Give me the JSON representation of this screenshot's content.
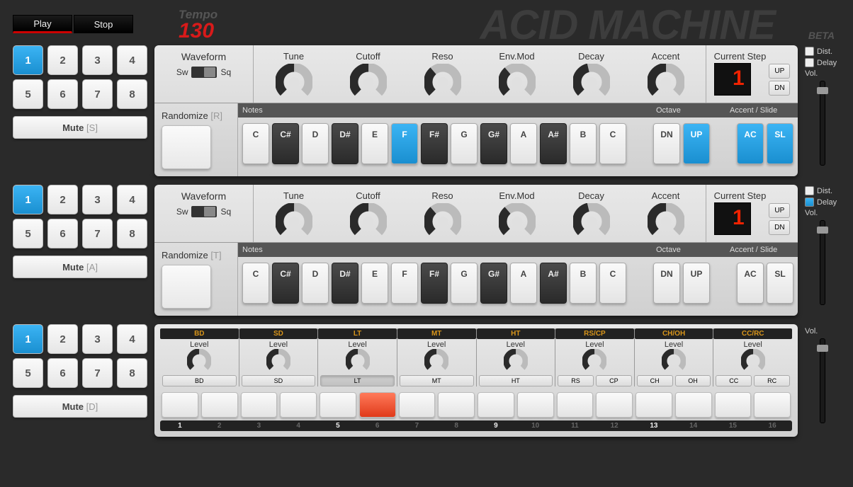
{
  "app": {
    "title": "ACID MACHINE",
    "beta": "BETA"
  },
  "transport": {
    "play": "Play",
    "stop": "Stop",
    "tempo_label": "Tempo",
    "tempo": "130"
  },
  "pattern_count": 8,
  "synth_labels": {
    "waveform": "Waveform",
    "sw": "Sw",
    "sq": "Sq",
    "knobs": [
      "Tune",
      "Cutoff",
      "Reso",
      "Env.Mod",
      "Decay",
      "Accent"
    ],
    "current_step": "Current Step",
    "up": "UP",
    "dn": "DN",
    "randomize": "Randomize",
    "notes_hdr": "Notes",
    "octave_hdr": "Octave",
    "accsl_hdr": "Accent / Slide",
    "notes": [
      "C",
      "C#",
      "D",
      "D#",
      "E",
      "F",
      "F#",
      "G",
      "G#",
      "A",
      "A#",
      "B",
      "C"
    ],
    "oct_dn": "DN",
    "oct_up": "UP",
    "ac": "AC",
    "sl": "SL",
    "level": "Level"
  },
  "synth1": {
    "active_pattern": 1,
    "mute_label": "Mute",
    "mute_key": "[S]",
    "rand_key": "[R]",
    "knob_values": [
      0.5,
      0.5,
      0.35,
      0.35,
      0.45,
      0.5
    ],
    "current_step": "1",
    "active_note": "F",
    "oct_active": "UP",
    "ac_on": true,
    "sl_on": true,
    "fx": {
      "dist_label": "Dist.",
      "dist_on": false,
      "delay_label": "Delay",
      "delay_on": false,
      "vol_label": "Vol."
    }
  },
  "synth2": {
    "active_pattern": 1,
    "mute_label": "Mute",
    "mute_key": "[A]",
    "rand_key": "[T]",
    "knob_values": [
      0.5,
      0.5,
      0.35,
      0.35,
      0.45,
      0.5
    ],
    "current_step": "1",
    "active_note": "",
    "oct_active": "",
    "ac_on": false,
    "sl_on": false,
    "fx": {
      "dist_label": "Dist.",
      "dist_on": false,
      "delay_label": "Delay",
      "delay_on": true,
      "vol_label": "Vol."
    }
  },
  "drums": {
    "active_pattern": 1,
    "mute_label": "Mute",
    "mute_key": "[D]",
    "lanes": [
      {
        "name": "BD",
        "btns": [
          "BD"
        ]
      },
      {
        "name": "SD",
        "btns": [
          "SD"
        ]
      },
      {
        "name": "LT",
        "btns": [
          "LT"
        ],
        "pressed": true
      },
      {
        "name": "MT",
        "btns": [
          "MT"
        ]
      },
      {
        "name": "HT",
        "btns": [
          "HT"
        ]
      },
      {
        "name": "RS/CP",
        "btns": [
          "RS",
          "CP"
        ]
      },
      {
        "name": "CH/OH",
        "btns": [
          "CH",
          "OH"
        ]
      },
      {
        "name": "CC/RC",
        "btns": [
          "CC",
          "RC"
        ]
      }
    ],
    "steps": 16,
    "active_step": 6,
    "vol_label": "Vol."
  }
}
